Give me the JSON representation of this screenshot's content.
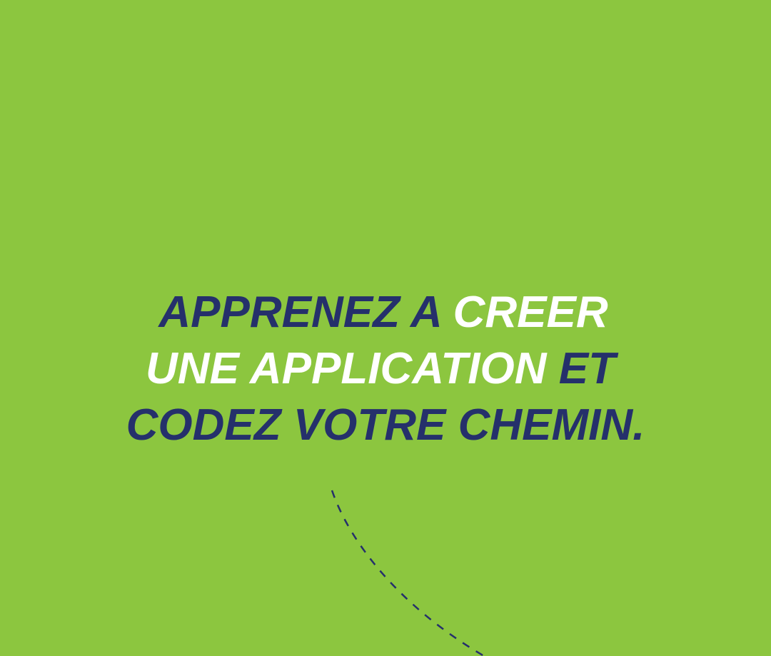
{
  "headline": {
    "line1": {
      "part1": "APPRENEZ A ",
      "part2": "CREER"
    },
    "line2": {
      "part1": "UNE APPLICATION ",
      "part2": "ET"
    },
    "line3": {
      "part1": "CODEZ VOTRE CHEMIN."
    }
  },
  "colors": {
    "background": "#8cc63f",
    "dark_text": "#25306b",
    "light_text": "#ffffff",
    "dashed_line": "#25306b"
  }
}
